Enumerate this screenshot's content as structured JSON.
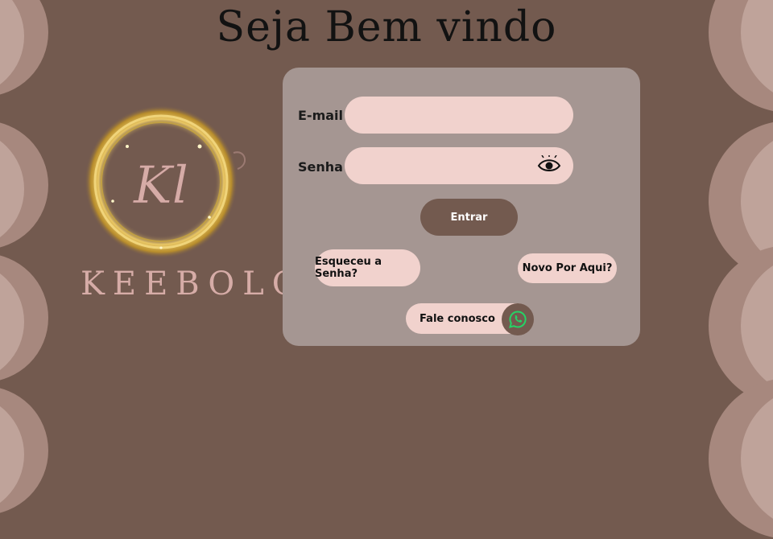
{
  "header": {
    "title": "Seja Bem vindo"
  },
  "logo": {
    "monogram": "Kl",
    "brand_name": "KEEBOLOS"
  },
  "form": {
    "email_label": "E-mail",
    "email_value": "",
    "password_label": "Senha",
    "password_value": "",
    "submit_label": "Entrar",
    "forgot_label": "Esqueceu a Senha?",
    "new_user_label": "Novo Por Aqui?",
    "contact_label": "Fale conosco"
  },
  "icons": {
    "password_toggle": "eye-icon",
    "contact": "whatsapp-icon"
  },
  "colors": {
    "background": "#735a4f",
    "panel": "#a59692",
    "field": "#f1d2cd",
    "primary_button": "#735a4f",
    "decor_outer": "#a7887e",
    "decor_inner": "#bfa39a",
    "whatsapp": "#25d366",
    "gold": "#d4af37"
  }
}
